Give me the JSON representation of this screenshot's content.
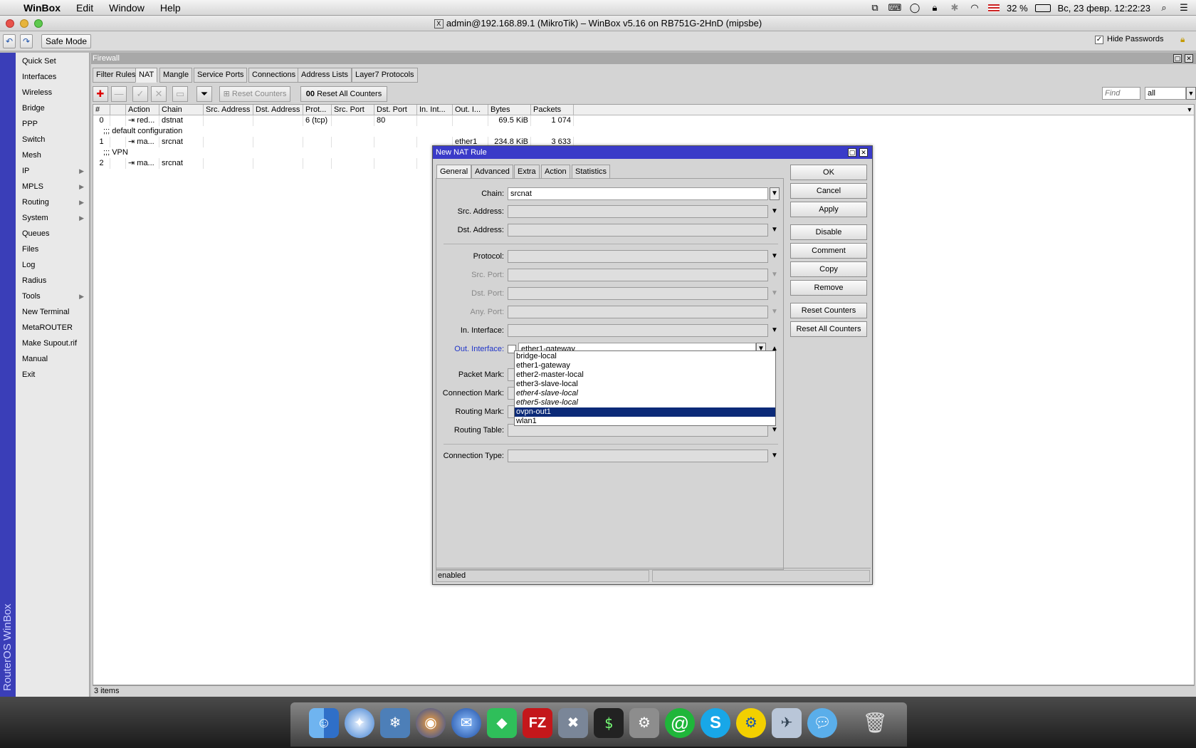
{
  "menubar": {
    "apple": "",
    "app": "WinBox",
    "items": [
      "Edit",
      "Window",
      "Help"
    ],
    "battery": "32 %",
    "datetime": "Вс, 23 февр.  12:22:23"
  },
  "window": {
    "title": "admin@192.168.89.1 (MikroTik) – WinBox v5.16 on RB751G-2HnD (mipsbe)"
  },
  "toolbar": {
    "safe_mode": "Safe Mode",
    "hide_passwords": "Hide Passwords"
  },
  "sidebar": {
    "brand": "RouterOS WinBox",
    "items": [
      {
        "label": "Quick Set",
        "arrow": ""
      },
      {
        "label": "Interfaces",
        "arrow": ""
      },
      {
        "label": "Wireless",
        "arrow": ""
      },
      {
        "label": "Bridge",
        "arrow": ""
      },
      {
        "label": "PPP",
        "arrow": ""
      },
      {
        "label": "Switch",
        "arrow": ""
      },
      {
        "label": "Mesh",
        "arrow": ""
      },
      {
        "label": "IP",
        "arrow": "▶"
      },
      {
        "label": "MPLS",
        "arrow": "▶"
      },
      {
        "label": "Routing",
        "arrow": "▶"
      },
      {
        "label": "System",
        "arrow": "▶"
      },
      {
        "label": "Queues",
        "arrow": ""
      },
      {
        "label": "Files",
        "arrow": ""
      },
      {
        "label": "Log",
        "arrow": ""
      },
      {
        "label": "Radius",
        "arrow": ""
      },
      {
        "label": "Tools",
        "arrow": "▶"
      },
      {
        "label": "New Terminal",
        "arrow": ""
      },
      {
        "label": "MetaROUTER",
        "arrow": ""
      },
      {
        "label": "Make Supout.rif",
        "arrow": ""
      },
      {
        "label": "Manual",
        "arrow": ""
      },
      {
        "label": "Exit",
        "arrow": ""
      }
    ]
  },
  "firewall": {
    "title": "Firewall",
    "tabs": [
      "Filter Rules",
      "NAT",
      "Mangle",
      "Service Ports",
      "Connections",
      "Address Lists",
      "Layer7 Protocols"
    ],
    "reset_counters": "Reset Counters",
    "reset_all_prefix": "00",
    "reset_all_counters": "Reset All Counters",
    "find_placeholder": "Find",
    "filter_value": "all",
    "columns": [
      "#",
      "",
      "Action",
      "Chain",
      "Src. Address",
      "Dst. Address",
      "Prot...",
      "Src. Port",
      "Dst. Port",
      "In. Int...",
      "Out. I...",
      "Bytes",
      "Packets"
    ],
    "comment1": ";;; default configuration",
    "comment2": ";;; VPN",
    "rows": [
      {
        "num": "0",
        "action": "red...",
        "chain": "dstnat",
        "proto": "6 (tcp)",
        "dst_port": "80",
        "out": "",
        "bytes": "69.5 KiB",
        "packets": "1 074"
      },
      {
        "num": "1",
        "action": "ma...",
        "chain": "srcnat",
        "proto": "",
        "dst_port": "",
        "out": "ether1",
        "bytes": "234.8 KiB",
        "packets": "3 633"
      },
      {
        "num": "2",
        "action": "ma...",
        "chain": "srcnat",
        "proto": "",
        "dst_port": "",
        "out": "",
        "bytes": "",
        "packets": ""
      }
    ],
    "status": "3 items"
  },
  "dialog": {
    "title": "New NAT Rule",
    "tabs": [
      "General",
      "Advanced",
      "Extra",
      "Action",
      "Statistics"
    ],
    "labels": {
      "chain": "Chain:",
      "src_address": "Src. Address:",
      "dst_address": "Dst. Address:",
      "protocol": "Protocol:",
      "src_port": "Src. Port:",
      "dst_port": "Dst. Port:",
      "any_port": "Any. Port:",
      "in_interface": "In. Interface:",
      "out_interface": "Out. Interface:",
      "packet_mark": "Packet Mark:",
      "connection_mark": "Connection Mark:",
      "routing_mark": "Routing Mark:",
      "routing_table": "Routing Table:",
      "connection_type": "Connection Type:"
    },
    "chain_value": "srcnat",
    "out_interface_value": "ether1-gateway",
    "options": [
      {
        "label": "bridge-local",
        "italic": false,
        "selected": false
      },
      {
        "label": "ether1-gateway",
        "italic": false,
        "selected": false
      },
      {
        "label": "ether2-master-local",
        "italic": false,
        "selected": false
      },
      {
        "label": "ether3-slave-local",
        "italic": false,
        "selected": false
      },
      {
        "label": "ether4-slave-local",
        "italic": true,
        "selected": false
      },
      {
        "label": "ether5-slave-local",
        "italic": true,
        "selected": false
      },
      {
        "label": "ovpn-out1",
        "italic": false,
        "selected": true
      },
      {
        "label": "wlan1",
        "italic": false,
        "selected": false
      }
    ],
    "buttons": [
      "OK",
      "Cancel",
      "Apply",
      "Disable",
      "Comment",
      "Copy",
      "Remove",
      "Reset Counters",
      "Reset All Counters"
    ],
    "status": "enabled"
  },
  "dock": {
    "icons": [
      "finder-icon",
      "safari-icon",
      "preview-icon",
      "firefox-icon",
      "thunderbird-icon",
      "cube-icon",
      "filezilla-icon",
      "winbox-icon",
      "terminal-icon",
      "system-preferences-icon",
      "mail-icon",
      "skype-icon",
      "ftp-icon",
      "mail-stamp-icon",
      "messages-icon",
      "trash-icon"
    ],
    "labels": {
      "filezilla": "FZ",
      "terminal": "$",
      "mail": "@",
      "skype": "S"
    }
  }
}
